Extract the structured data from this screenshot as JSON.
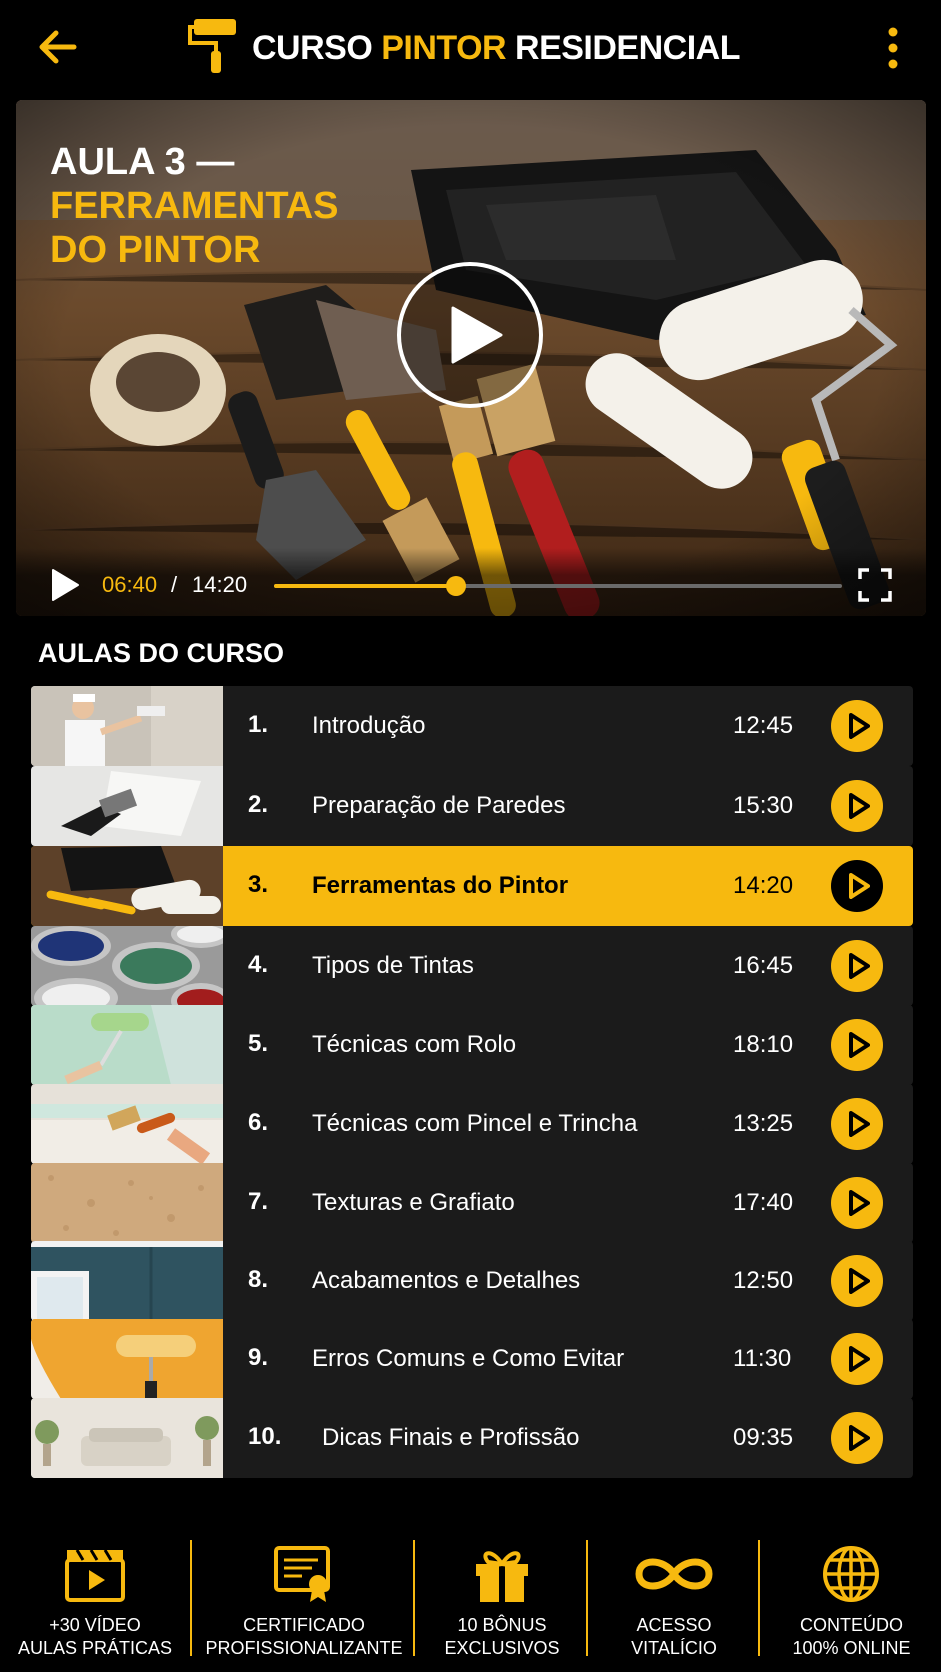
{
  "header": {
    "title_part1": "CURSO ",
    "title_part2": "PINTOR",
    "title_part3": " RESIDENCIAL",
    "back_icon": "arrow-left-icon",
    "menu_icon": "more-vertical-icon",
    "logo_icon": "paint-roller-icon"
  },
  "video": {
    "lesson_line1": "AULA 3 —",
    "lesson_line2": "FERRAMENTAS",
    "lesson_line3": "DO PINTOR",
    "current_time": "06:40",
    "separator": "/",
    "total_time": "14:20",
    "progress": 0.32
  },
  "section_title": "AULAS DO CURSO",
  "lessons": [
    {
      "num": "1.",
      "title": "Introdução",
      "duration": "12:45",
      "active": false,
      "thumb": "painter-roller-wall"
    },
    {
      "num": "2.",
      "title": "Preparação de Paredes",
      "duration": "15:30",
      "active": false,
      "thumb": "spackle-wall"
    },
    {
      "num": "3.",
      "title": "Ferramentas do Pintor",
      "duration": "14:20",
      "active": true,
      "thumb": "painter-tools"
    },
    {
      "num": "4.",
      "title": "Tipos de Tintas",
      "duration": "16:45",
      "active": false,
      "thumb": "paint-cans"
    },
    {
      "num": "5.",
      "title": "Técnicas com Rolo",
      "duration": "18:10",
      "active": false,
      "thumb": "green-roller"
    },
    {
      "num": "6.",
      "title": "Técnicas com Pincel e Trincha",
      "duration": "13:25",
      "active": false,
      "thumb": "brush-trim"
    },
    {
      "num": "7.",
      "title": "Texturas e Grafiato",
      "duration": "17:40",
      "active": false,
      "thumb": "texture"
    },
    {
      "num": "8.",
      "title": "Acabamentos e Detalhes",
      "duration": "12:50",
      "active": false,
      "thumb": "finished-room"
    },
    {
      "num": "9.",
      "title": "Erros Comuns e Como Evitar",
      "duration": "11:30",
      "active": false,
      "thumb": "yellow-roller"
    },
    {
      "num": "10.",
      "title": "Dicas Finais e Profissão",
      "duration": "09:35",
      "active": false,
      "thumb": "living-room"
    }
  ],
  "features": [
    {
      "line1": "+30 VÍDEO",
      "line2": "AULAS PRÁTICAS",
      "icon": "video-clapper-icon"
    },
    {
      "line1": "CERTIFICADO",
      "line2": "PROFISSIONALIZANTE",
      "icon": "certificate-icon"
    },
    {
      "line1": "10 BÔNUS",
      "line2": "EXCLUSIVOS",
      "icon": "gift-icon"
    },
    {
      "line1": "ACESSO",
      "line2": "VITALÍCIO",
      "icon": "infinity-icon"
    },
    {
      "line1": "CONTEÚDO",
      "line2": "100% ONLINE",
      "icon": "globe-icon"
    }
  ],
  "colors": {
    "accent": "#F7B90F",
    "background": "#000000",
    "row_bg": "#1B1B1B"
  }
}
